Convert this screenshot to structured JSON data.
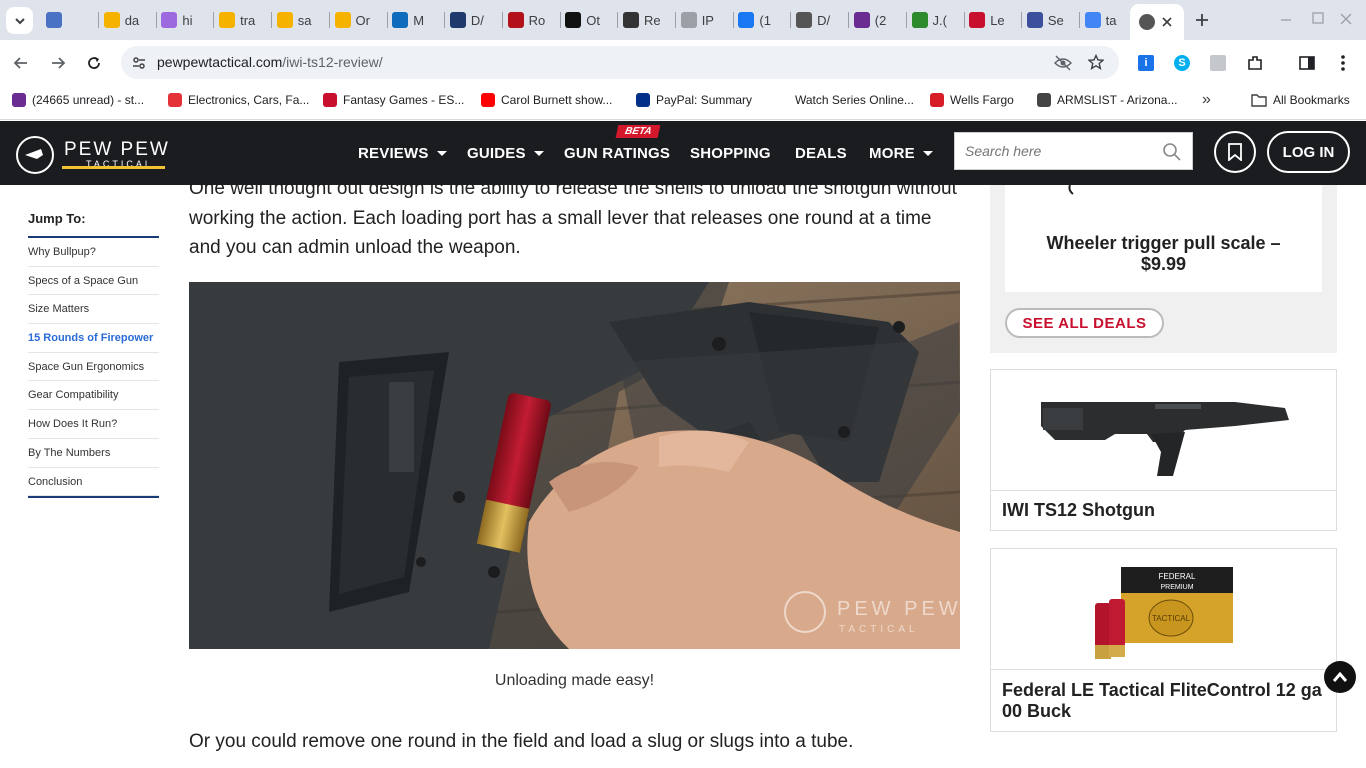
{
  "browser": {
    "tabs": [
      {
        "label": "",
        "icon": "mountain-icon"
      },
      {
        "label": "da",
        "icon": "shopping-icon"
      },
      {
        "label": "hi",
        "icon": "target-icon"
      },
      {
        "label": "tra",
        "icon": "shopping-icon"
      },
      {
        "label": "sa",
        "icon": "shopping-icon"
      },
      {
        "label": "Or",
        "icon": "shopping-icon"
      },
      {
        "label": "M",
        "icon": "outlook-icon"
      },
      {
        "label": "D/",
        "icon": "g-icon"
      },
      {
        "label": "Ro",
        "icon": "r-icon"
      },
      {
        "label": "Ot",
        "icon": "dark-circle-icon"
      },
      {
        "label": "Re",
        "icon": "texas-icon"
      },
      {
        "label": "IP",
        "icon": "globe-icon"
      },
      {
        "label": "(1",
        "icon": "facebook-icon"
      },
      {
        "label": "D/",
        "icon": "rifle-icon"
      },
      {
        "label": "(2",
        "icon": "mail-icon"
      },
      {
        "label": "J.(",
        "icon": "gun-icon"
      },
      {
        "label": "Le",
        "icon": "fantasy-icon"
      },
      {
        "label": "Se",
        "icon": "shield-icon"
      },
      {
        "label": "ta",
        "icon": "google-icon"
      }
    ],
    "active_tab_icon": "pewpew-icon",
    "url_host": "pewpewtactical.com",
    "url_path": "/iwi-ts12-review/",
    "bookmarks": [
      {
        "label": "(24665 unread) - st...",
        "icon": "mail-icon"
      },
      {
        "label": "Electronics, Cars, Fa...",
        "icon": "ebay-icon"
      },
      {
        "label": "Fantasy Games - ES...",
        "icon": "fantasy-icon"
      },
      {
        "label": "Carol Burnett show...",
        "icon": "youtube-icon"
      },
      {
        "label": "PayPal: Summary",
        "icon": "paypal-icon"
      },
      {
        "label": "Watch Series Online...",
        "icon": "blank-icon"
      },
      {
        "label": "Wells Fargo",
        "icon": "wellsfargo-icon"
      },
      {
        "label": "ARMSLIST - Arizona...",
        "icon": "armslist-icon"
      }
    ],
    "all_bookmarks": "All Bookmarks"
  },
  "site": {
    "logo_main": "PEW PEW",
    "logo_sub": "TACTICAL",
    "nav": [
      {
        "label": "REVIEWS",
        "dropdown": true
      },
      {
        "label": "GUIDES",
        "dropdown": true
      },
      {
        "label": "GUN RATINGS",
        "dropdown": false
      },
      {
        "label": "SHOPPING",
        "dropdown": false
      },
      {
        "label": "DEALS",
        "dropdown": false
      },
      {
        "label": "MORE",
        "dropdown": true
      }
    ],
    "beta_badge": "BETA",
    "search_placeholder": "Search here",
    "login": "LOG IN"
  },
  "toc": {
    "title": "Jump To:",
    "items": [
      "Why Bullpup?",
      "Specs of a Space Gun",
      "Size Matters",
      "15 Rounds of Firepower",
      "Space Gun Ergonomics",
      "Gear Compatibility",
      "How Does It Run?",
      "By The Numbers",
      "Conclusion"
    ],
    "active_index": 3
  },
  "article": {
    "para1": "One well thought out design is the ability to release the shells to unload the shotgun without working the action. Each loading port has a small lever that releases one round at a time and you can admin unload the weapon.",
    "caption": "Unloading made easy!",
    "watermark": "PEW PEW",
    "watermark_sub": "TACTICAL",
    "para2": "Or you could remove one round in the field and load a slug or slugs into a tube."
  },
  "sidebar": {
    "deal_name": "Wheeler trigger pull scale – $9.99",
    "see_all": "SEE ALL DEALS",
    "products": [
      {
        "name": "IWI TS12 Shotgun"
      },
      {
        "name": "Federal LE Tactical FliteControl 12 ga 00 Buck"
      }
    ]
  },
  "colors": {
    "accent_red": "#c8102e",
    "nav_bg": "#1b1c1f",
    "logo_yellow": "#f2c230",
    "toc_active": "#2a6bd8"
  }
}
